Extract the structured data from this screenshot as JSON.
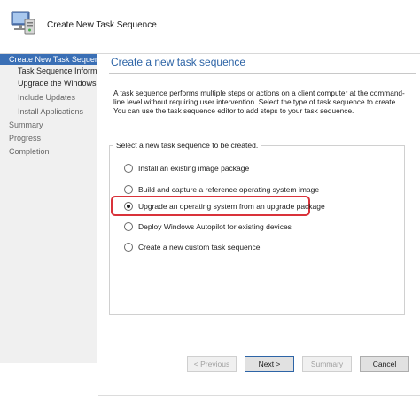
{
  "header": {
    "title": "Create New Task Sequence",
    "icon": "computer-wizard-icon"
  },
  "sidebar": {
    "items": [
      {
        "label": "Create New Task Sequence",
        "state": "selected"
      },
      {
        "label": "Task Sequence Informatio",
        "state": "normal"
      },
      {
        "label": "Upgrade the Windows Op",
        "state": "normal"
      },
      {
        "label": "Include Updates",
        "state": "pending"
      },
      {
        "label": "Install Applications",
        "state": "pending"
      },
      {
        "label": "Summary",
        "state": "pending"
      },
      {
        "label": "Progress",
        "state": "pending"
      },
      {
        "label": "Completion",
        "state": "pending"
      }
    ]
  },
  "main": {
    "title": "Create a new task sequence",
    "description": "A task sequence performs multiple steps or actions on a client computer at the command-line level without requiring user intervention. Select the type of task sequence to create. You can use the task sequence editor to add steps to your task sequence.",
    "group_label": "Select a new task sequence to be created.",
    "options": [
      {
        "label": "Install an existing image package",
        "selected": false
      },
      {
        "label": "Build and capture a reference operating system image",
        "selected": false
      },
      {
        "label": "Upgrade an operating system from an upgrade package",
        "selected": true
      },
      {
        "label": "Deploy Windows Autopilot for existing devices",
        "selected": false
      },
      {
        "label": "Create a new custom task sequence",
        "selected": false
      }
    ]
  },
  "footer": {
    "previous_label": "< Previous",
    "next_label": "Next >",
    "summary_label": "Summary",
    "cancel_label": "Cancel"
  },
  "colors": {
    "accent": "#2d64a6",
    "sidebar_selected": "#3a6fb5",
    "highlight_border": "#d9323a"
  }
}
